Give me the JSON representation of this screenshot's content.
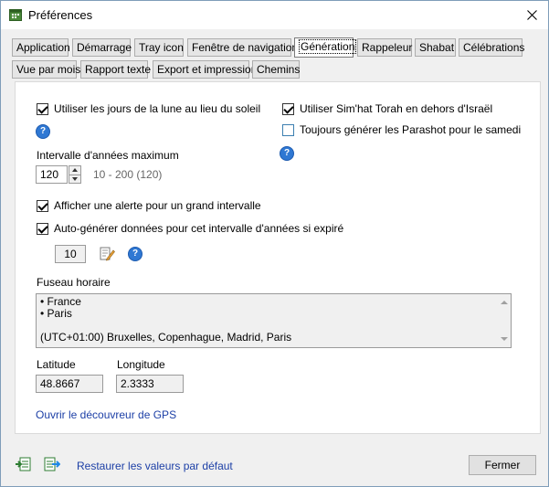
{
  "window": {
    "title": "Préférences"
  },
  "tabs_row1": [
    "Application",
    "Démarrage",
    "Tray icon",
    "Fenêtre de navigation",
    "Génération",
    "Rappeleur",
    "Shabat",
    "Célébrations"
  ],
  "tabs_row2": [
    "Vue par mois",
    "Rapport texte",
    "Export et impression",
    "Chemins"
  ],
  "active_tab": "Génération",
  "options": {
    "moon_days": {
      "label": "Utiliser les jours de la lune au lieu du soleil",
      "checked": true
    },
    "simhat_torah": {
      "label": "Utiliser Sim'hat Torah en dehors d'Israël",
      "checked": true
    },
    "parashot": {
      "label": "Toujours générer les Parashot pour le samedi",
      "checked": false
    },
    "alert_interval": {
      "label": "Afficher une alerte pour un grand intervalle",
      "checked": true
    },
    "autogen": {
      "label": "Auto-générer données pour cet intervalle d'années si expiré",
      "checked": true
    }
  },
  "interval": {
    "label": "Intervalle d'années maximum",
    "value": "120",
    "range": "10 - 200 (120)"
  },
  "autogen_value": "10",
  "timezone": {
    "label": "Fuseau horaire",
    "lines": [
      "• France",
      "• Paris",
      "",
      "(UTC+01:00) Bruxelles, Copenhague, Madrid, Paris"
    ]
  },
  "latitude": {
    "label": "Latitude",
    "value": "48.8667"
  },
  "longitude": {
    "label": "Longitude",
    "value": "2.3333"
  },
  "gps_link": "Ouvrir le découvreur de GPS",
  "restore_link": "Restaurer les valeurs par défaut",
  "close_button": "Fermer",
  "help_glyph": "?"
}
